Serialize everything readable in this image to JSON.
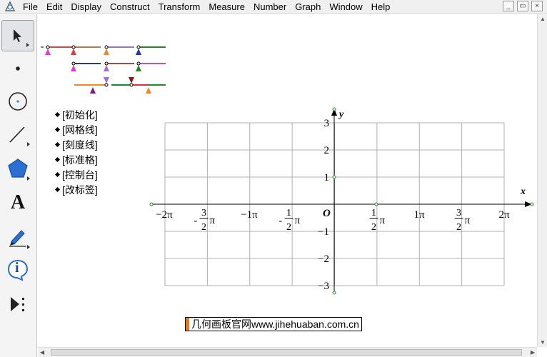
{
  "menu": {
    "items": [
      {
        "name": "menu-file",
        "label": "File"
      },
      {
        "name": "menu-edit",
        "label": "Edit"
      },
      {
        "name": "menu-display",
        "label": "Display"
      },
      {
        "name": "menu-construct",
        "label": "Construct"
      },
      {
        "name": "menu-transform",
        "label": "Transform"
      },
      {
        "name": "menu-measure",
        "label": "Measure"
      },
      {
        "name": "menu-number",
        "label": "Number"
      },
      {
        "name": "menu-graph",
        "label": "Graph"
      },
      {
        "name": "menu-window",
        "label": "Window"
      },
      {
        "name": "menu-help",
        "label": "Help"
      }
    ],
    "window_buttons": {
      "minimize": "_",
      "restore": "▭",
      "close": "×"
    }
  },
  "toolbox": {
    "tools": [
      {
        "name": "arrow-tool",
        "icon": "arrow-select-icon"
      },
      {
        "name": "point-tool",
        "icon": "point-icon"
      },
      {
        "name": "compass-tool",
        "icon": "circle-icon"
      },
      {
        "name": "straightedge-tool",
        "icon": "segment-icon"
      },
      {
        "name": "polygon-tool",
        "icon": "polygon-icon"
      },
      {
        "name": "text-tool",
        "icon": "text-a-icon",
        "glyph": "A"
      },
      {
        "name": "marker-tool",
        "icon": "pen-icon"
      },
      {
        "name": "information-tool",
        "icon": "info-icon",
        "glyph": "i"
      },
      {
        "name": "custom-tool",
        "icon": "custom-tool-icon"
      }
    ]
  },
  "action_buttons": [
    {
      "name": "init-button",
      "label": "[初始化]"
    },
    {
      "name": "grid-line-button",
      "label": "[网格线]"
    },
    {
      "name": "tick-line-button",
      "label": "[刻度线]"
    },
    {
      "name": "standard-grid-button",
      "label": "[标准格]"
    },
    {
      "name": "control-panel-button",
      "label": "[控制台]"
    },
    {
      "name": "edit-labels-button",
      "label": "[改标签]"
    }
  ],
  "graph": {
    "x_axis_label": "x",
    "y_axis_label": "y",
    "origin_label": "O",
    "x_ticks": [
      {
        "label": "−2π"
      },
      {
        "numerator": "3",
        "denominator": "2",
        "prefix": "-",
        "suffix": "π"
      },
      {
        "label": "−1π"
      },
      {
        "numerator": "1",
        "denominator": "2",
        "prefix": "-",
        "suffix": "π"
      },
      {
        "numerator": "1",
        "denominator": "2",
        "prefix": "",
        "suffix": "π"
      },
      {
        "label": "1π"
      },
      {
        "numerator": "3",
        "denominator": "2",
        "prefix": "",
        "suffix": "π"
      },
      {
        "label": "2π"
      }
    ],
    "y_ticks": [
      "3",
      "2",
      "1",
      "−1",
      "−2",
      "−3"
    ],
    "x_range": [
      "−2π",
      "2π"
    ],
    "y_range": [
      -3,
      3
    ],
    "grid": true
  },
  "watermark": "几何画板官网www.jihehuaban.com.cn",
  "colors": {
    "accent_orange": "#e87722",
    "axis_point": "#2a8a2a"
  }
}
